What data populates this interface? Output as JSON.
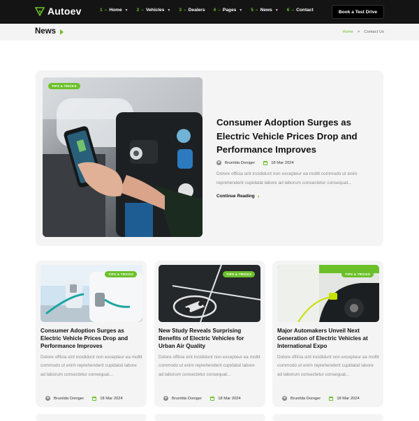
{
  "header": {
    "logo_text": "Autoev",
    "nav": [
      {
        "num": "1",
        "label": "Home",
        "has_caret": true
      },
      {
        "num": "2",
        "label": "Vehicles",
        "has_caret": true
      },
      {
        "num": "3",
        "label": "Dealers",
        "has_caret": false
      },
      {
        "num": "4",
        "label": "Pages",
        "has_caret": true
      },
      {
        "num": "5",
        "label": "News",
        "has_caret": true
      },
      {
        "num": "6",
        "label": "Contact",
        "has_caret": false
      }
    ],
    "cta_label": "Book a Test Drive"
  },
  "breadcrumb": {
    "page_title": "News",
    "home": "Home",
    "separator": ">",
    "current": "Contact Us"
  },
  "featured": {
    "tag": "TIPS & TRICKS",
    "title": "Consumer Adoption Surges as Electric Vehicle Prices Drop and Performance Improves",
    "author": "Brunilda Doniger",
    "date": "18 Mar 2024",
    "description": "Dolore officia sint incididunt non excepteur ea mollit commodo ut enim reprehenderit cupidatat labore ad laborum consectetur consequat...",
    "read_more": "Continue Reading"
  },
  "cards": [
    {
      "tag": "TIPS & TRICKS",
      "title": "Consumer Adoption Surges as Electric Vehicle Prices Drop and Performance Improves",
      "description": "Dolore officia sint incididunt non excepteur ea mollit commodo ut enim reprehenderit cupidatat labore ad laborum consectetur consequat...",
      "author": "Brunilda Doniger",
      "date": "18 Mar 2024"
    },
    {
      "tag": "TIPS & TRICKS",
      "title": "New Study Reveals Surprising Benefits of Electric Vehicles for Urban Air Quality",
      "description": "Dolore officia sint incididunt non excepteur ea mollit commodo ut enim reprehenderit cupidatat labore ad laborum consectetur consequat...",
      "author": "Brunilda Doniger",
      "date": "18 Mar 2024"
    },
    {
      "tag": "TIPS & TRICKS",
      "title": "Major Automakers Unveil Next Generation of Electric Vehicles at International Expo",
      "description": "Dolore officia sint incididunt non excepteur ea mollit commodo ut enim reprehenderit cupidatat labore ad laborum consectetur consequat...",
      "author": "Brunilda Doniger",
      "date": "18 Mar 2024"
    }
  ],
  "colors": {
    "accent": "#6cc12a",
    "header_bg": "#141414",
    "card_bg": "#f4f4f4",
    "muted_text": "#8a8a8a"
  }
}
